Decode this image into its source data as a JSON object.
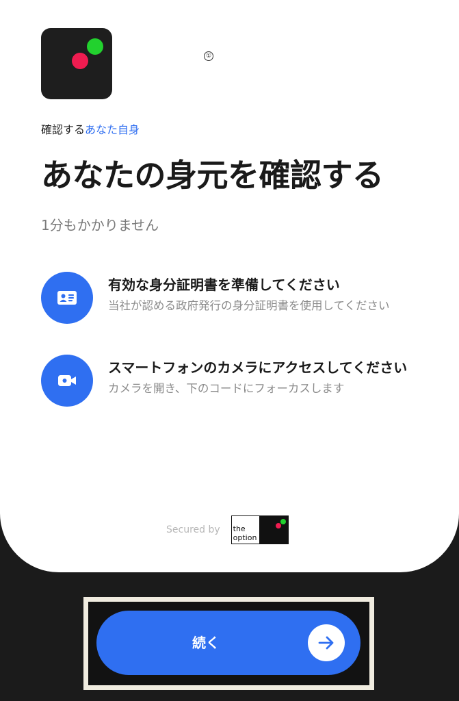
{
  "header": {
    "info_glyph": "①"
  },
  "eyebrow": {
    "prefix": "確認する",
    "accent": "あなた自身"
  },
  "title": "あなたの身元を確認する",
  "subtitle": "1分もかかりません",
  "steps": [
    {
      "icon": "id-card-icon",
      "title": "有効な身分証明書を準備してください",
      "description": "当社が認める政府発行の身分証明書を使用してください"
    },
    {
      "icon": "video-camera-icon",
      "title": "スマートフォンのカメラにアクセスしてください",
      "description": "カメラを開き、下のコードにフォーカスします"
    }
  ],
  "footer": {
    "secured_by": "Secured by",
    "partner_logo_text": "the option"
  },
  "actions": {
    "continue_label": "続く"
  },
  "colors": {
    "accent": "#2f6ff1",
    "background_dark": "#1b1b1b",
    "logo_green": "#22d12e",
    "logo_red": "#ef1c50"
  }
}
